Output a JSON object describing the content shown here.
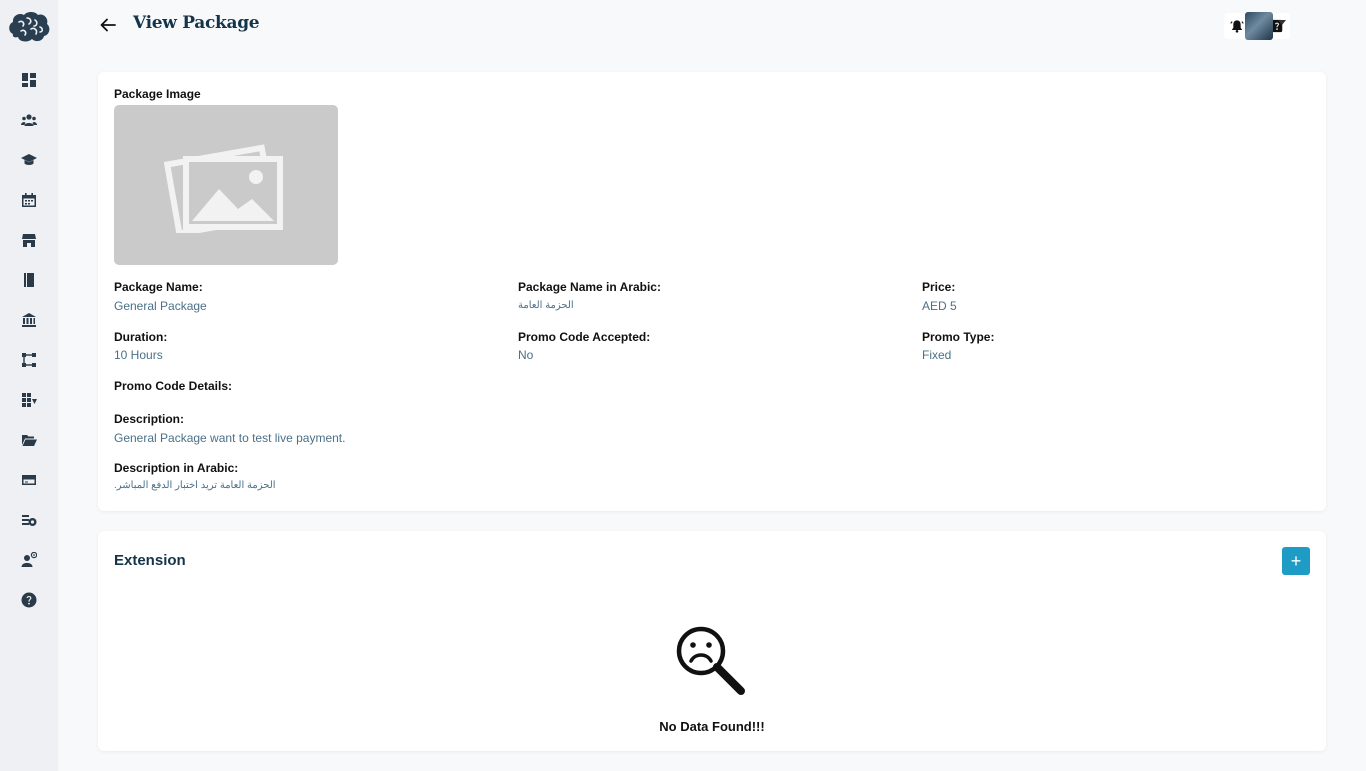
{
  "header": {
    "title": "View Package"
  },
  "sidebar": {
    "items": [
      {
        "icon": "dashboard-icon"
      },
      {
        "icon": "users-icon"
      },
      {
        "icon": "graduation-cap-icon"
      },
      {
        "icon": "calendar-icon"
      },
      {
        "icon": "store-icon"
      },
      {
        "icon": "book-icon"
      },
      {
        "icon": "bank-icon"
      },
      {
        "icon": "workflow-icon"
      },
      {
        "icon": "grid-arrow-icon"
      },
      {
        "icon": "folder-open-icon"
      },
      {
        "icon": "credit-card-icon"
      },
      {
        "icon": "money-icon"
      },
      {
        "icon": "user-settings-icon"
      },
      {
        "icon": "help-icon"
      }
    ]
  },
  "package": {
    "image_label": "Package Image",
    "name_label": "Package Name:",
    "name": "General Package",
    "name_ar_label": "Package Name in Arabic:",
    "name_ar": "الحزمة العامة",
    "price_label": "Price:",
    "price": "AED 5",
    "duration_label": "Duration:",
    "duration": "10 Hours",
    "promo_accepted_label": "Promo Code Accepted:",
    "promo_accepted": "No",
    "promo_type_label": "Promo Type:",
    "promo_type": "Fixed",
    "promo_details_label": "Promo Code Details:",
    "description_label": "Description:",
    "description": "General Package want to test live payment.",
    "description_ar_label": "Description in Arabic:",
    "description_ar": "الحزمة العامة تريد اختبار الدفع المباشر."
  },
  "extension": {
    "title": "Extension",
    "add_label": "+",
    "empty_text": "No Data Found!!!"
  },
  "colors": {
    "accent": "#1f9cc5",
    "title": "#15344a",
    "value": "#4a7088",
    "sidebar_bg": "#eef0f3"
  }
}
